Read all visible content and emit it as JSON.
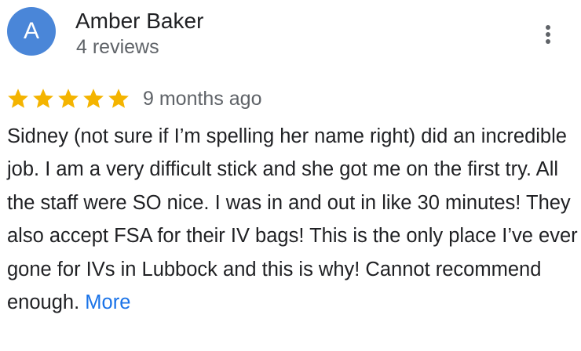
{
  "review": {
    "author": {
      "avatar_letter": "A",
      "avatar_color": "#4a86d8",
      "name": "Amber Baker",
      "review_count": "4 reviews"
    },
    "menu_icon": "more-vert-icon",
    "rating": 5,
    "rating_max": 5,
    "star_color": "#f4b400",
    "date": "9 months ago",
    "text": "Sidney (not sure if I’m spelling her name right) did an incredible job. I am a very difficult stick and she got me on the first try. All the staff were SO nice. I was in and out in like 30 minutes! They also accept FSA for their IV bags! This is the only place I’ve ever gone for IVs in Lubbock and this is why! Cannot recommend enough.",
    "more_label": "More",
    "link_color": "#1a73e8"
  }
}
